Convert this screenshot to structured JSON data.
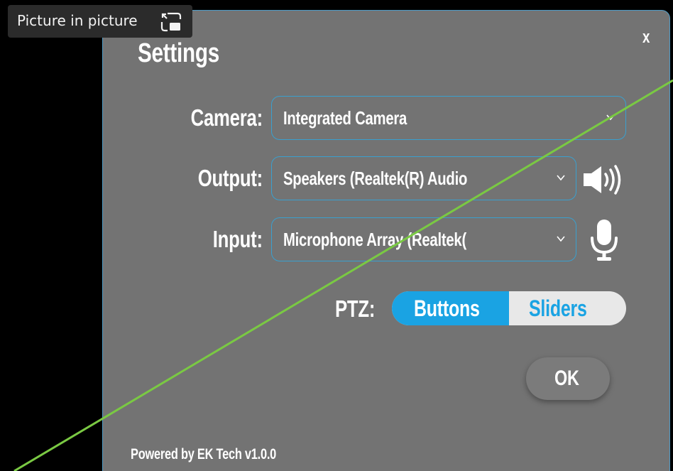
{
  "pip_tooltip": {
    "label": "Picture in picture",
    "icon": "picture-in-picture-icon"
  },
  "dialog": {
    "title": "Settings",
    "close_label": "x",
    "camera": {
      "label": "Camera:",
      "value": "Integrated Camera"
    },
    "output": {
      "label": "Output:",
      "value": "Speakers (Realtek(R) Audio",
      "icon": "speaker-icon"
    },
    "input": {
      "label": "Input:",
      "value": "Microphone Array (Realtek(",
      "icon": "microphone-icon"
    },
    "ptz": {
      "label": "PTZ:",
      "options": [
        "Buttons",
        "Sliders"
      ],
      "selected": "Buttons"
    },
    "ok_label": "OK",
    "footer": "Powered by EK Tech v1.0.0"
  },
  "colors": {
    "dialog_bg": "#737373",
    "accent": "#1aa3e3",
    "border": "#3aa0cf",
    "annotation_line": "#7ac943"
  }
}
